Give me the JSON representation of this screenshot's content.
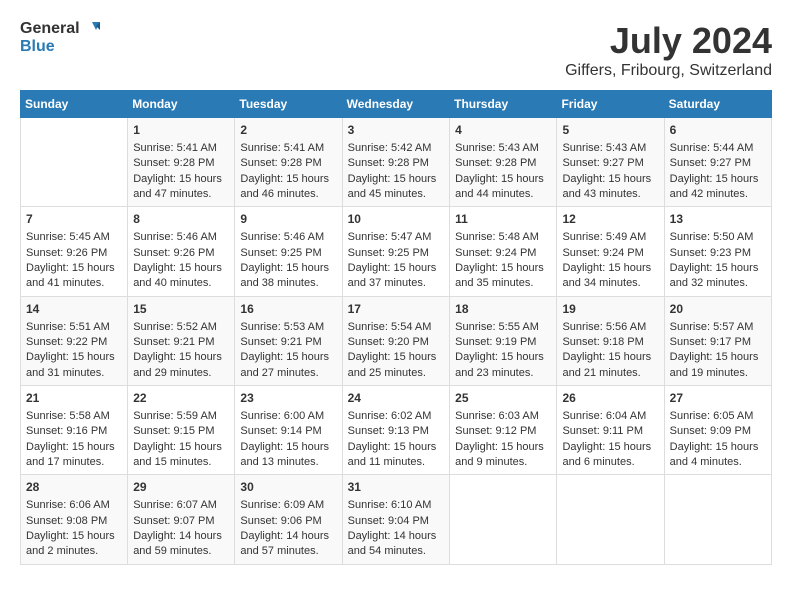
{
  "header": {
    "logo_general": "General",
    "logo_blue": "Blue",
    "month_year": "July 2024",
    "location": "Giffers, Fribourg, Switzerland"
  },
  "calendar": {
    "days_of_week": [
      "Sunday",
      "Monday",
      "Tuesday",
      "Wednesday",
      "Thursday",
      "Friday",
      "Saturday"
    ],
    "weeks": [
      [
        {
          "day": "",
          "content": ""
        },
        {
          "day": "1",
          "content": "Sunrise: 5:41 AM\nSunset: 9:28 PM\nDaylight: 15 hours\nand 47 minutes."
        },
        {
          "day": "2",
          "content": "Sunrise: 5:41 AM\nSunset: 9:28 PM\nDaylight: 15 hours\nand 46 minutes."
        },
        {
          "day": "3",
          "content": "Sunrise: 5:42 AM\nSunset: 9:28 PM\nDaylight: 15 hours\nand 45 minutes."
        },
        {
          "day": "4",
          "content": "Sunrise: 5:43 AM\nSunset: 9:28 PM\nDaylight: 15 hours\nand 44 minutes."
        },
        {
          "day": "5",
          "content": "Sunrise: 5:43 AM\nSunset: 9:27 PM\nDaylight: 15 hours\nand 43 minutes."
        },
        {
          "day": "6",
          "content": "Sunrise: 5:44 AM\nSunset: 9:27 PM\nDaylight: 15 hours\nand 42 minutes."
        }
      ],
      [
        {
          "day": "7",
          "content": "Sunrise: 5:45 AM\nSunset: 9:26 PM\nDaylight: 15 hours\nand 41 minutes."
        },
        {
          "day": "8",
          "content": "Sunrise: 5:46 AM\nSunset: 9:26 PM\nDaylight: 15 hours\nand 40 minutes."
        },
        {
          "day": "9",
          "content": "Sunrise: 5:46 AM\nSunset: 9:25 PM\nDaylight: 15 hours\nand 38 minutes."
        },
        {
          "day": "10",
          "content": "Sunrise: 5:47 AM\nSunset: 9:25 PM\nDaylight: 15 hours\nand 37 minutes."
        },
        {
          "day": "11",
          "content": "Sunrise: 5:48 AM\nSunset: 9:24 PM\nDaylight: 15 hours\nand 35 minutes."
        },
        {
          "day": "12",
          "content": "Sunrise: 5:49 AM\nSunset: 9:24 PM\nDaylight: 15 hours\nand 34 minutes."
        },
        {
          "day": "13",
          "content": "Sunrise: 5:50 AM\nSunset: 9:23 PM\nDaylight: 15 hours\nand 32 minutes."
        }
      ],
      [
        {
          "day": "14",
          "content": "Sunrise: 5:51 AM\nSunset: 9:22 PM\nDaylight: 15 hours\nand 31 minutes."
        },
        {
          "day": "15",
          "content": "Sunrise: 5:52 AM\nSunset: 9:21 PM\nDaylight: 15 hours\nand 29 minutes."
        },
        {
          "day": "16",
          "content": "Sunrise: 5:53 AM\nSunset: 9:21 PM\nDaylight: 15 hours\nand 27 minutes."
        },
        {
          "day": "17",
          "content": "Sunrise: 5:54 AM\nSunset: 9:20 PM\nDaylight: 15 hours\nand 25 minutes."
        },
        {
          "day": "18",
          "content": "Sunrise: 5:55 AM\nSunset: 9:19 PM\nDaylight: 15 hours\nand 23 minutes."
        },
        {
          "day": "19",
          "content": "Sunrise: 5:56 AM\nSunset: 9:18 PM\nDaylight: 15 hours\nand 21 minutes."
        },
        {
          "day": "20",
          "content": "Sunrise: 5:57 AM\nSunset: 9:17 PM\nDaylight: 15 hours\nand 19 minutes."
        }
      ],
      [
        {
          "day": "21",
          "content": "Sunrise: 5:58 AM\nSunset: 9:16 PM\nDaylight: 15 hours\nand 17 minutes."
        },
        {
          "day": "22",
          "content": "Sunrise: 5:59 AM\nSunset: 9:15 PM\nDaylight: 15 hours\nand 15 minutes."
        },
        {
          "day": "23",
          "content": "Sunrise: 6:00 AM\nSunset: 9:14 PM\nDaylight: 15 hours\nand 13 minutes."
        },
        {
          "day": "24",
          "content": "Sunrise: 6:02 AM\nSunset: 9:13 PM\nDaylight: 15 hours\nand 11 minutes."
        },
        {
          "day": "25",
          "content": "Sunrise: 6:03 AM\nSunset: 9:12 PM\nDaylight: 15 hours\nand 9 minutes."
        },
        {
          "day": "26",
          "content": "Sunrise: 6:04 AM\nSunset: 9:11 PM\nDaylight: 15 hours\nand 6 minutes."
        },
        {
          "day": "27",
          "content": "Sunrise: 6:05 AM\nSunset: 9:09 PM\nDaylight: 15 hours\nand 4 minutes."
        }
      ],
      [
        {
          "day": "28",
          "content": "Sunrise: 6:06 AM\nSunset: 9:08 PM\nDaylight: 15 hours\nand 2 minutes."
        },
        {
          "day": "29",
          "content": "Sunrise: 6:07 AM\nSunset: 9:07 PM\nDaylight: 14 hours\nand 59 minutes."
        },
        {
          "day": "30",
          "content": "Sunrise: 6:09 AM\nSunset: 9:06 PM\nDaylight: 14 hours\nand 57 minutes."
        },
        {
          "day": "31",
          "content": "Sunrise: 6:10 AM\nSunset: 9:04 PM\nDaylight: 14 hours\nand 54 minutes."
        },
        {
          "day": "",
          "content": ""
        },
        {
          "day": "",
          "content": ""
        },
        {
          "day": "",
          "content": ""
        }
      ]
    ]
  }
}
